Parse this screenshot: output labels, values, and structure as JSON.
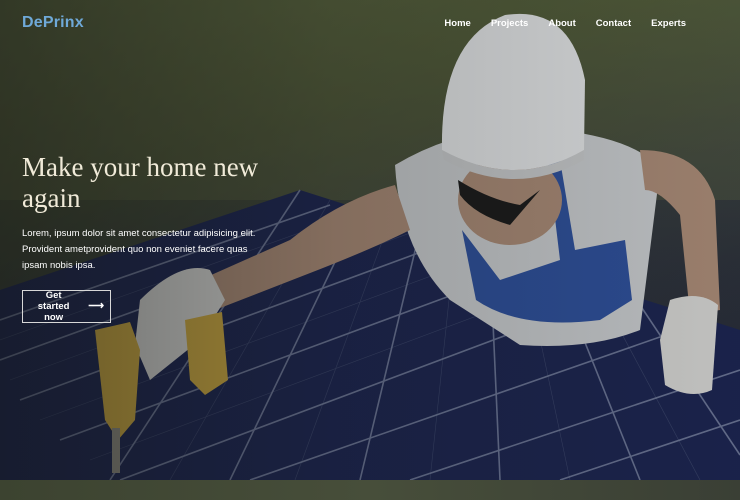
{
  "brand": {
    "name": "DePrinx"
  },
  "nav": {
    "items": [
      {
        "label": "Home"
      },
      {
        "label": "Projects"
      },
      {
        "label": "About"
      },
      {
        "label": "Contact"
      },
      {
        "label": "Experts"
      }
    ]
  },
  "hero": {
    "title": "Make your home new again",
    "text": "Lorem, ipsum dolor sit amet consectetur adipisicing elit. Provident ametprovident quo non eveniet facere quas ipsam nobis ipsa.",
    "cta_label": "Get started now",
    "cta_icon": "arrow-right-icon",
    "image": "solar-panel-installer-photo"
  },
  "colors": {
    "brand": "#6fa9d8",
    "title": "#f0ead8"
  }
}
